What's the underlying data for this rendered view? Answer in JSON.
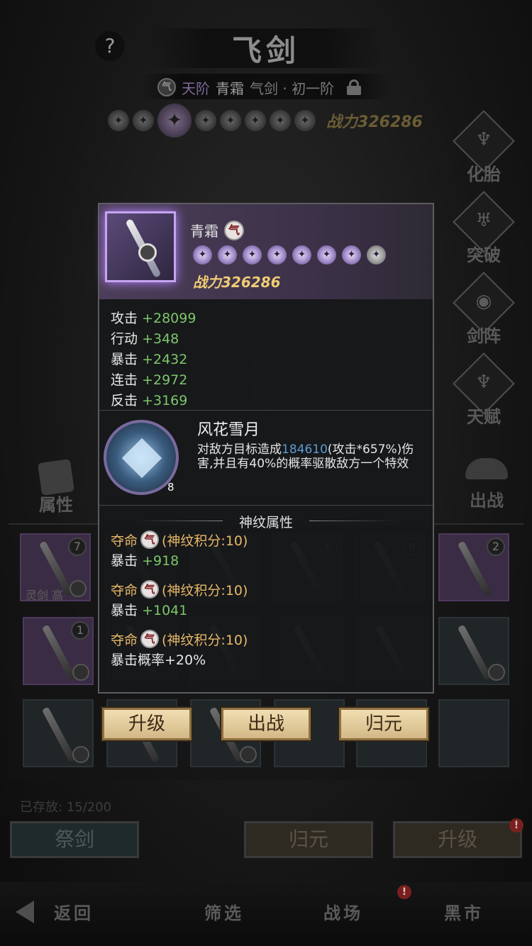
{
  "header": {
    "help_glyph": "?",
    "title": "飞剑",
    "tier": "天阶",
    "sword_name": "青霜",
    "sword_type": "气剑 · 初一阶",
    "power_label": "战力",
    "power_value": "326286"
  },
  "side_menu": [
    {
      "label": "化胎",
      "icon": "transform-icon"
    },
    {
      "label": "突破",
      "icon": "breakthrough-icon"
    },
    {
      "label": "剑阵",
      "icon": "sword-array-icon"
    },
    {
      "label": "天赋",
      "icon": "talent-icon"
    }
  ],
  "attr_button": {
    "label": "属性"
  },
  "deploy_button": {
    "label": "出战"
  },
  "inventory": {
    "slot_tag": "灵剑 高",
    "counts": [
      "7",
      "6",
      "6",
      "2",
      "1"
    ],
    "storage_label": "已存放:",
    "storage_value": "15/200"
  },
  "bottom_buttons": {
    "sacrifice": "祭剑",
    "return": "归元",
    "upgrade": "升级",
    "badge": "!"
  },
  "nav": {
    "back": "返回",
    "filter": "筛选",
    "battlefield": "战场",
    "black_market": "黑市",
    "badge": "!"
  },
  "popup": {
    "name": "青霜",
    "type_glyph": "气",
    "power_label": "战力",
    "power_value": "326286",
    "stats": [
      {
        "label": "攻击",
        "value": "+28099"
      },
      {
        "label": "行动",
        "value": "+348"
      },
      {
        "label": "暴击",
        "value": "+2432"
      },
      {
        "label": "连击",
        "value": "+2972"
      },
      {
        "label": "反击",
        "value": "+3169"
      }
    ],
    "skill": {
      "name": "风花雪月",
      "level": "8",
      "desc_pre": "对敌方目标造成",
      "desc_num": "184610",
      "desc_post": "(攻击*657%)伤害,并且有40%的概率驱散敌方一个特效"
    },
    "section_title": "神纹属性",
    "runes": [
      {
        "name": "夺命",
        "points": "(神纹积分:10)",
        "stat_label": "暴击",
        "stat_value": "+918"
      },
      {
        "name": "夺命",
        "points": "(神纹积分:10)",
        "stat_label": "暴击",
        "stat_value": "+1041"
      },
      {
        "name": "夺命",
        "points": "(神纹积分:10)",
        "stat_label": "暴击概率+20%",
        "stat_value": ""
      }
    ],
    "actions": {
      "upgrade": "升级",
      "deploy": "出战",
      "return": "归元"
    }
  }
}
